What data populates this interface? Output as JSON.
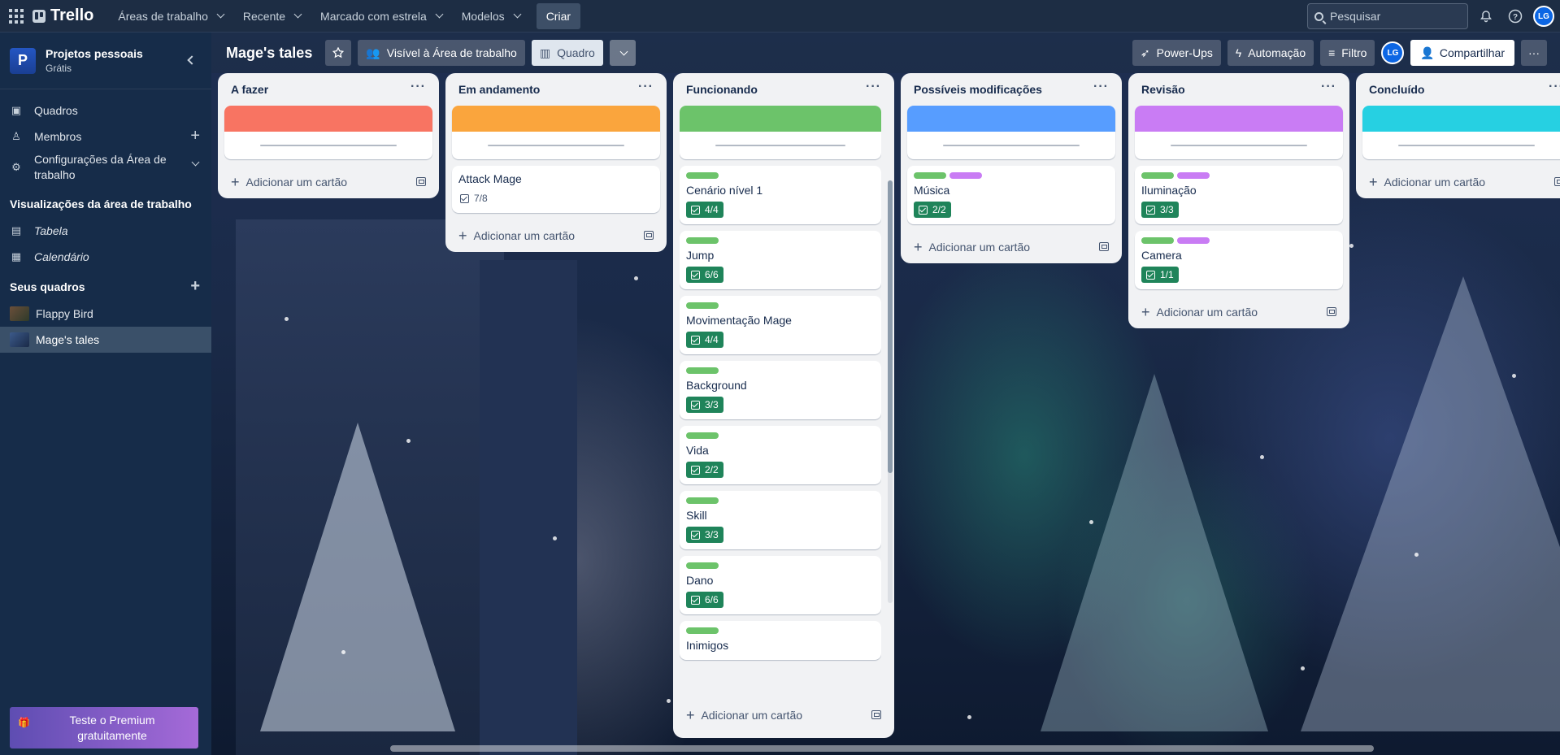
{
  "topbar": {
    "brand": "Trello",
    "nav": [
      "Áreas de trabalho",
      "Recente",
      "Marcado com estrela",
      "Modelos"
    ],
    "create": "Criar",
    "search_placeholder": "Pesquisar",
    "avatar": "LG"
  },
  "sidebar": {
    "workspace_initial": "P",
    "workspace_name": "Projetos pessoais",
    "workspace_plan": "Grátis",
    "items": [
      {
        "label": "Quadros",
        "icon": "trello-board-icon"
      },
      {
        "label": "Membros",
        "icon": "person-icon"
      },
      {
        "label": "Configurações da Área de trabalho",
        "icon": "gear-icon"
      }
    ],
    "views_title": "Visualizações da área de trabalho",
    "views": [
      {
        "label": "Tabela",
        "icon": "table-icon"
      },
      {
        "label": "Calendário",
        "icon": "calendar-icon"
      }
    ],
    "boards_title": "Seus quadros",
    "boards": [
      {
        "label": "Flappy Bird"
      },
      {
        "label": "Mage's tales"
      }
    ],
    "premium": "Teste o Premium gratuitamente"
  },
  "board": {
    "title": "Mage's tales",
    "visibility": "Visível à Área de trabalho",
    "view": "Quadro",
    "powerups": "Power-Ups",
    "automation": "Automação",
    "filter": "Filtro",
    "avatar": "LG",
    "share": "Compartilhar",
    "add_card": "Adicionar um cartão"
  },
  "colors": {
    "red": "#f87462",
    "orange": "#faa53d",
    "green": "#6cc36a",
    "blue": "#579dff",
    "purple": "#c97cf4",
    "cyan": "#26d0e2",
    "pink": "#da62ac",
    "badge_green": "#1f845a"
  },
  "lists": [
    {
      "title": "A fazer",
      "cards": [
        {
          "cover": "red"
        }
      ]
    },
    {
      "title": "Em andamento",
      "cards": [
        {
          "cover": "orange"
        },
        {
          "title": "Attack Mage",
          "checklist": "7/8",
          "complete": false
        }
      ]
    },
    {
      "title": "Funcionando",
      "cards": [
        {
          "cover": "green"
        },
        {
          "labels": [
            "green"
          ],
          "title": "Cenário nível 1",
          "checklist": "4/4",
          "complete": true
        },
        {
          "labels": [
            "green"
          ],
          "title": "Jump",
          "checklist": "6/6",
          "complete": true
        },
        {
          "labels": [
            "green"
          ],
          "title": "Movimentação Mage",
          "checklist": "4/4",
          "complete": true
        },
        {
          "labels": [
            "green"
          ],
          "title": "Background",
          "checklist": "3/3",
          "complete": true
        },
        {
          "labels": [
            "green"
          ],
          "title": "Vida",
          "checklist": "2/2",
          "complete": true
        },
        {
          "labels": [
            "green"
          ],
          "title": "Skill",
          "checklist": "3/3",
          "complete": true
        },
        {
          "labels": [
            "green"
          ],
          "title": "Dano",
          "checklist": "6/6",
          "complete": true
        },
        {
          "labels": [
            "green"
          ],
          "title": "Inimigos"
        }
      ]
    },
    {
      "title": "Possíveis modificações",
      "cards": [
        {
          "cover": "blue"
        },
        {
          "labels": [
            "green",
            "purple"
          ],
          "title": "Música",
          "checklist": "2/2",
          "complete": true
        }
      ]
    },
    {
      "title": "Revisão",
      "cards": [
        {
          "cover": "purple"
        },
        {
          "labels": [
            "green",
            "purple"
          ],
          "title": "Iluminação",
          "checklist": "3/3",
          "complete": true
        },
        {
          "labels": [
            "green",
            "purple"
          ],
          "title": "Camera",
          "checklist": "1/1",
          "complete": true
        }
      ]
    },
    {
      "title": "Concluído",
      "cards": [
        {
          "cover": "cyan"
        }
      ]
    }
  ]
}
